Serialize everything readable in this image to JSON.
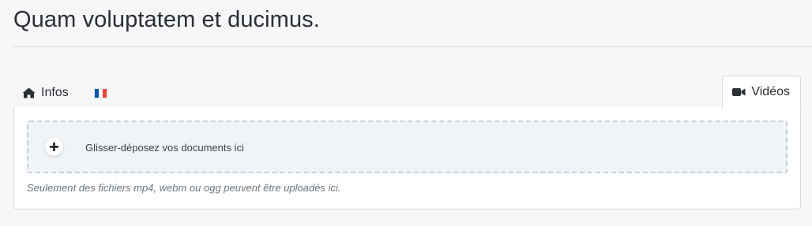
{
  "page": {
    "title": "Quam voluptatem et ducimus."
  },
  "tabs": [
    {
      "label": "Infos",
      "icon": "home-icon",
      "active": false
    },
    {
      "label": "",
      "icon": "french-flag-icon",
      "active": false,
      "flag_colors": [
        "#0055a4",
        "#ffffff",
        "#ef4135"
      ]
    },
    {
      "label": "Vidéos",
      "icon": "video-camera-icon",
      "active": true
    }
  ],
  "upload": {
    "dropzone_label": "Glisser-déposez vos documents ici",
    "add_icon": "plus-icon",
    "help_text": "Seulement des fichiers mp4, webm ou ogg peuvent être uploadés ici."
  },
  "colors": {
    "background": "#f6f7f9",
    "border": "#d7dadd",
    "dropzone_bg": "#f1f4f7",
    "dropzone_border": "#c5d0da"
  }
}
